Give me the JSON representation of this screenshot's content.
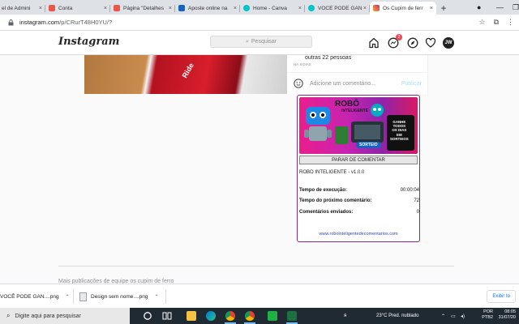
{
  "browser": {
    "tabs": [
      {
        "title": "el de Admini",
        "favicon_color": "#e8574a"
      },
      {
        "title": "Conta",
        "favicon_color": "#e8574a"
      },
      {
        "title": "Página \"Detalhes",
        "favicon_color": "#e8574a"
      },
      {
        "title": "Aposte online na",
        "favicon_color": "#1565c0"
      },
      {
        "title": "Home - Canva",
        "favicon_color": "#00c4cc"
      },
      {
        "title": "VOCÊ PODE GAN",
        "favicon_color": "#00c4cc"
      },
      {
        "title": "Os Cupim de ferr",
        "favicon_color": "#c13584",
        "active": true
      }
    ],
    "new_tab": "+",
    "close": "×",
    "window_controls": [
      "●",
      "—",
      "❐"
    ],
    "url_host": "instagram.com",
    "url_path": "/p/CRurT48H0YU/?"
  },
  "instagram": {
    "logo": "Instagram",
    "search_placeholder": "Pesquisar",
    "notification_count": "2",
    "avatar_initials": "JW"
  },
  "post": {
    "likes_text": "outras 22 pessoas",
    "time_ago": "HÁ 8 DIAS",
    "comment_placeholder": "Adicione um comentário...",
    "publish_label": "Publicar",
    "photo_text": "Ride"
  },
  "bot": {
    "banner_title_1": "ROBÔ",
    "banner_title_2": "INTELIGENTE",
    "banner_sorteio": "SORTEIO",
    "banner_ganhe": "GANHE\nTODOS\nOS DIAS\nEM\nSORTEIOS",
    "stop_button": "PARAR DE COMENTAR",
    "version": "ROBO INTELIGENTE - v1.0.0",
    "exec_label": "Tempo de execução:",
    "exec_value": "00:00:04",
    "next_label": "Tempo do próximo comentário:",
    "next_value": "72",
    "sent_label": "Comentários enviados:",
    "sent_value": "0",
    "site": "www.robointeligentedecomentarios.com"
  },
  "page": {
    "more_from": "Mais publicações de equipe os cupim de ferro"
  },
  "downloads": {
    "items": [
      "VOCÊ PODE GAN....png",
      "Design sem nome....png"
    ],
    "show_all": "Exibir to"
  },
  "taskbar": {
    "search_placeholder": "Digite aqui para pesquisar",
    "weather": "23°C  Pred. nublado",
    "lang_1": "POR",
    "lang_2": "PTB2",
    "time": "08:05",
    "date": "31/07/20"
  }
}
